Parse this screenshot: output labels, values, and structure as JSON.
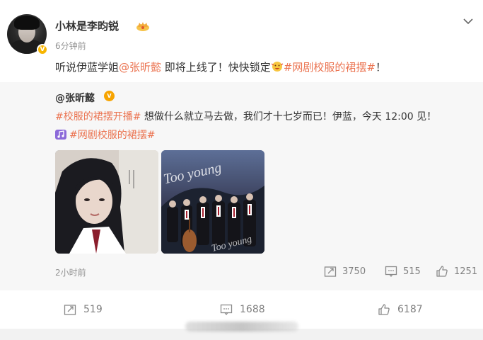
{
  "post": {
    "username": "小林是李昀锐",
    "time": "6分钟前",
    "text_parts": {
      "intro": "听说伊蓝学姐",
      "mention": "@张昕懿",
      "middle": " 即将上线了！快快锁定",
      "tag": "#网剧校服的裙摆#",
      "end": "！"
    }
  },
  "repost": {
    "author": "@张昕懿",
    "tag1": "#校服的裙摆开播#",
    "text": " 想做什么就立马去做，我们才十七岁而已！伊蓝，今天 12:00 见！",
    "tag2": "#网剧校服的裙摆#",
    "time": "2小时前",
    "share_count": "3750",
    "comment_count": "515",
    "like_count": "1251",
    "poster_text": "Too young",
    "poster_text2": "Too young"
  },
  "actions": {
    "share_count": "519",
    "comment_count": "1688",
    "like_count": "6187"
  },
  "colors": {
    "accent": "#eb7350",
    "verified": "#f7b500",
    "muted": "#939393"
  },
  "icons": [
    "more-chevron-icon",
    "crown-icon",
    "emoji-face-icon",
    "music-icon",
    "share-icon",
    "comment-icon",
    "like-icon"
  ]
}
